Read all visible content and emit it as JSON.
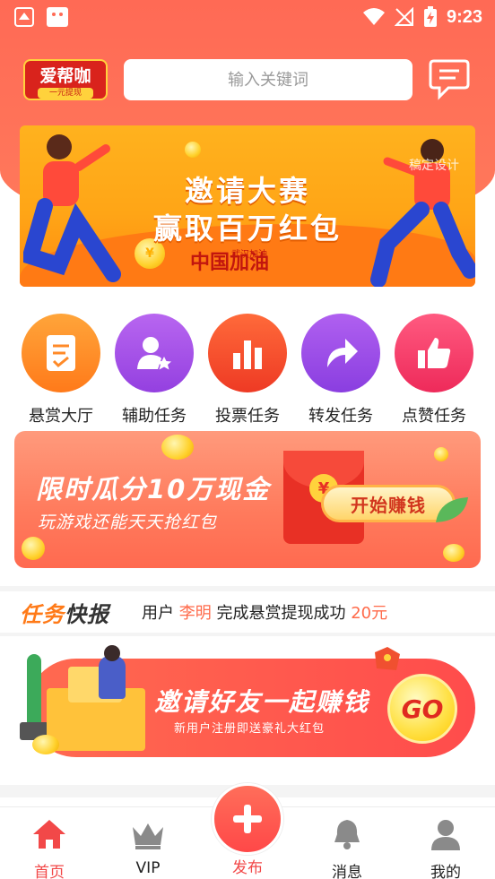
{
  "status_bar": {
    "time": "9:23"
  },
  "header": {
    "logo_text": "爱帮咖",
    "logo_sub": "一元提现",
    "search_placeholder": "输入关键词"
  },
  "banner_invite_contest": {
    "title_line1": "邀请大赛",
    "title_line2": "赢取百万红包",
    "slogan": "中国加油",
    "slogan_small": "武汉加油",
    "watermark": "稿定设计",
    "coin_symbol": "¥"
  },
  "categories": [
    {
      "label": "悬赏大厅",
      "icon": "task-doc-icon",
      "color": "#ff8a28"
    },
    {
      "label": "辅助任务",
      "icon": "user-star-icon",
      "color": "#a24ee6"
    },
    {
      "label": "投票任务",
      "icon": "bar-chart-icon",
      "color": "#f24a2c"
    },
    {
      "label": "转发任务",
      "icon": "share-arrow-icon",
      "color": "#9a46e6"
    },
    {
      "label": "点赞任务",
      "icon": "thumbs-up-icon",
      "color": "#f23a6a"
    }
  ],
  "banner_cash": {
    "title": "限时瓜分10万现金",
    "subtitle": "玩游戏还能天天抢红包",
    "button": "开始赚钱",
    "coin_symbol": "¥"
  },
  "ticker": {
    "tag_part1": "任务",
    "tag_part2": "快报",
    "prefix": "用户",
    "user": "李明",
    "middle": "完成悬赏提现成功",
    "amount": "20元"
  },
  "banner_invite_friends": {
    "title": "邀请好友一起赚钱",
    "subtitle": "新用户注册即送豪礼大红包",
    "button": "GO"
  },
  "tabbar": {
    "items": [
      {
        "label": "首页",
        "icon": "home-icon",
        "active": true
      },
      {
        "label": "VIP",
        "icon": "crown-icon",
        "active": false
      },
      {
        "label": "发布",
        "icon": "plus-icon",
        "active": false
      },
      {
        "label": "消息",
        "icon": "bell-icon",
        "active": false
      },
      {
        "label": "我的",
        "icon": "person-icon",
        "active": false
      }
    ]
  },
  "colors": {
    "primary": "#ff6a55",
    "active_tab": "#f24848",
    "highlight_text": "#ff6a4a"
  }
}
